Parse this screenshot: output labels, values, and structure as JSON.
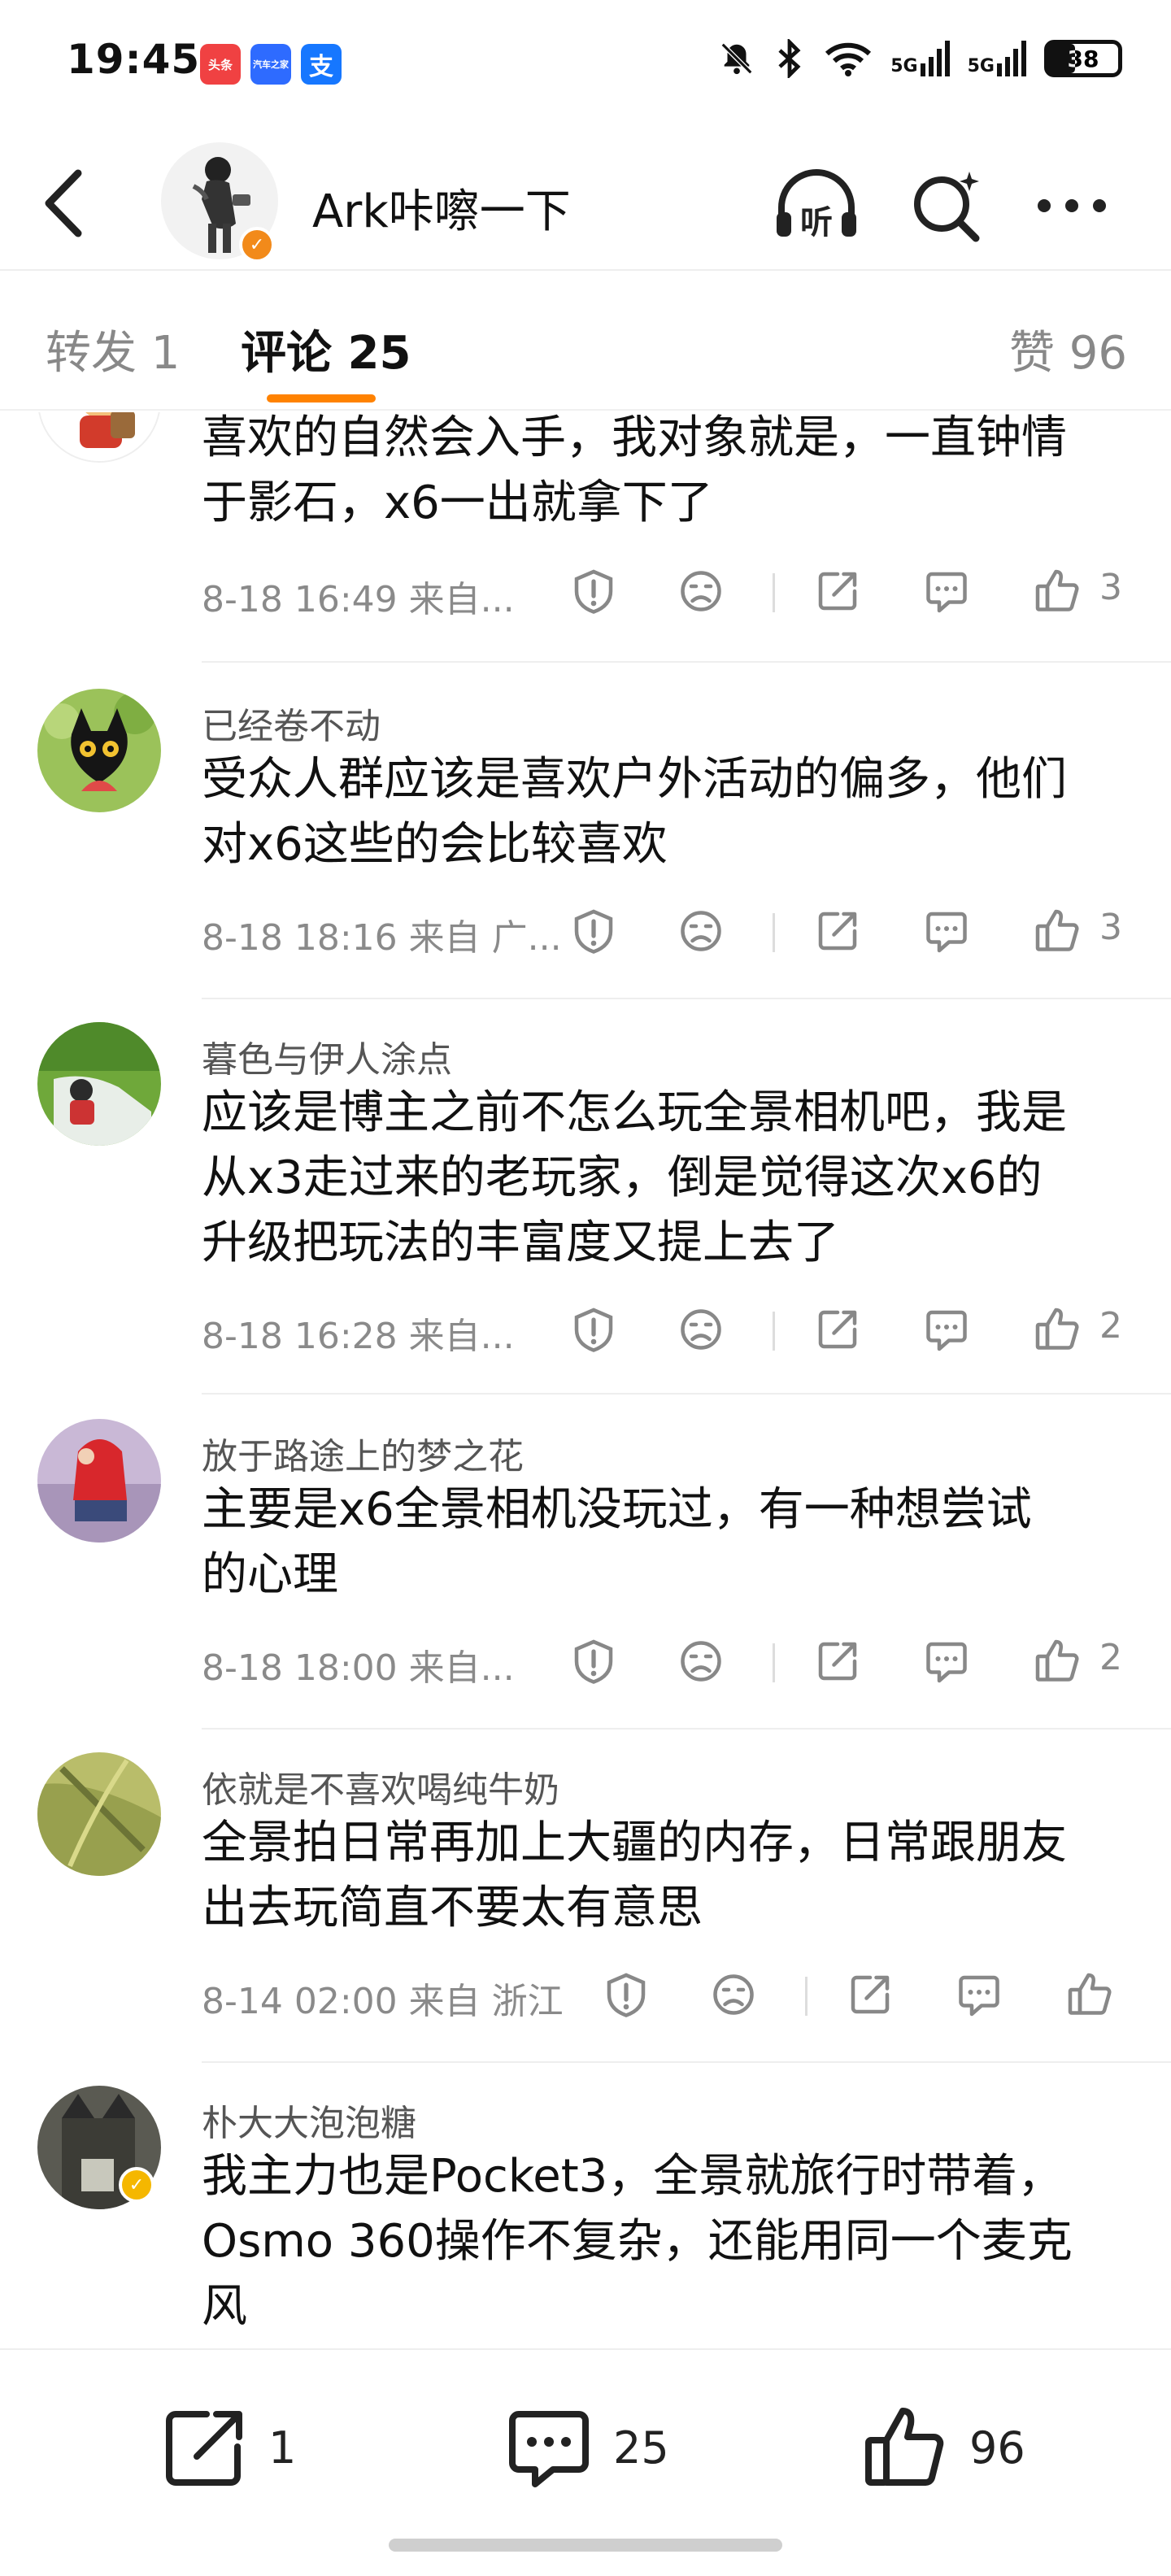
{
  "status": {
    "time": "19:45",
    "apps": [
      {
        "name": "toutiao-app-icon",
        "label": "头条",
        "color": "#f04142"
      },
      {
        "name": "autohome-app-icon",
        "label": "汽车之家",
        "color": "#2e6bff"
      },
      {
        "name": "alipay-app-icon",
        "label": "支",
        "color": "#1677ff"
      }
    ],
    "signal1": "5G",
    "signal2": "5G",
    "battery": "38"
  },
  "header": {
    "title": "Ark咔嚓一下",
    "icons": [
      "back-arrow-icon",
      "listen-icon",
      "search-spark-icon",
      "more-dots-icon"
    ],
    "listen_label": "听"
  },
  "tabs": {
    "repost": "转发 1",
    "comments": "评论 25",
    "likes": "赞 96"
  },
  "comments": [
    {
      "username": "",
      "text_lines": [
        "喜欢的自然会入手，我对象就是，一直钟情",
        "于影石，x6一出就拿下了"
      ],
      "meta": "8-18 16:49  来自...",
      "likes": "3"
    },
    {
      "username": "已经卷不动",
      "text_lines": [
        "受众人群应该是喜欢户外活动的偏多，他们",
        "对x6这些的会比较喜欢"
      ],
      "meta": "8-18 18:16  来自 广...",
      "likes": "3"
    },
    {
      "username": "暮色与伊人涂点",
      "text_lines": [
        "应该是博主之前不怎么玩全景相机吧，我是",
        "从x3走过来的老玩家，倒是觉得这次x6的",
        "升级把玩法的丰富度又提上去了"
      ],
      "meta": "8-18 16:28  来自...",
      "likes": "2"
    },
    {
      "username": "放于路途上的梦之花",
      "text_lines": [
        "主要是x6全景相机没玩过，有一种想尝试",
        "的心理"
      ],
      "meta": "8-18 18:00  来自...",
      "likes": "2"
    },
    {
      "username": "依就是不喜欢喝纯牛奶",
      "text_lines": [
        "全景拍日常再加上大疆的内存，日常跟朋友",
        "出去玩简直不要太有意思"
      ],
      "meta": "8-14 02:00  来自 浙江",
      "likes": ""
    },
    {
      "username": "朴大大泡泡糖",
      "text_lines": [
        "我主力也是Pocket3，全景就旅行时带着，",
        "Osmo 360操作不复杂，还能用同一个麦克",
        "风"
      ],
      "meta": "",
      "likes": ""
    }
  ],
  "bottom_bar": {
    "repost_count": "1",
    "comment_count": "25",
    "like_count": "96"
  },
  "colors": {
    "accent": "#ff8200",
    "verified_orange": "#f28a1a",
    "verified_gold": "#f5b700",
    "text_gray": "#8a8a8a"
  }
}
